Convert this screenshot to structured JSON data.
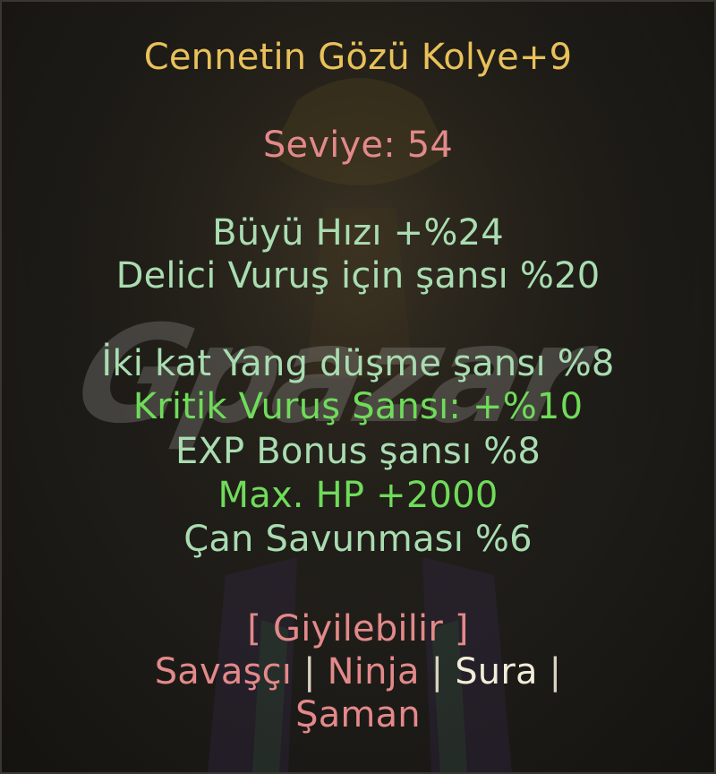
{
  "item": {
    "name": "Cennetin Gözü Kolye+9",
    "level": "Seviye: 54"
  },
  "bonuses_group1": [
    {
      "text": "Büyü Hızı +%24",
      "tone": "pale"
    },
    {
      "text": "Delici Vuruş için şansı %20",
      "tone": "pale"
    }
  ],
  "bonuses_group2": [
    {
      "text": "İki kat Yang düşme şansı %8",
      "tone": "pale"
    },
    {
      "text": "Kritik Vuruş Şansı: +%10",
      "tone": "bright"
    },
    {
      "text": "EXP Bonus şansı %8",
      "tone": "pale"
    },
    {
      "text": "Max. HP +2000",
      "tone": "bright"
    },
    {
      "text": "Çan Savunması %6",
      "tone": "pale"
    }
  ],
  "wearable": {
    "label": "[ Giyilebilir ]",
    "classes": [
      {
        "name": "Savaşçı",
        "active": false
      },
      {
        "name": "Ninja",
        "active": false
      },
      {
        "name": "Sura",
        "active": true
      },
      {
        "name": "Şaman",
        "active": false
      }
    ],
    "separator": "|"
  },
  "watermark": "Gpazar",
  "colors": {
    "title": "#e9c15a",
    "level": "#e3898a",
    "bonus_pale": "#a9ddb1",
    "bonus_bright": "#6fdc5a",
    "class_active": "#f2ecd8"
  }
}
